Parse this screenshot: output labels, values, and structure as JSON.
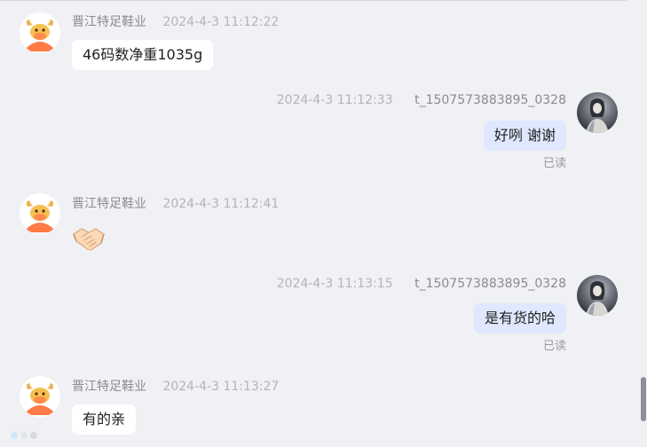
{
  "messages": [
    {
      "side": "left",
      "sender": "晋江特足鞋业",
      "time": "2024-4-3 11:12:22",
      "text": "46码数净重1035g"
    },
    {
      "side": "right",
      "sender": "t_1507573883895_0328",
      "time": "2024-4-3 11:12:33",
      "text": "好咧 谢谢",
      "status": "已读"
    },
    {
      "side": "left",
      "sender": "晋江特足鞋业",
      "time": "2024-4-3 11:12:41",
      "emoji": "handshake-emoji"
    },
    {
      "side": "right",
      "sender": "t_1507573883895_0328",
      "time": "2024-4-3 11:13:15",
      "text": "是有货的哈",
      "status": "已读"
    },
    {
      "side": "left",
      "sender": "晋江特足鞋业",
      "time": "2024-4-3 11:13:27",
      "text": "有的亲"
    }
  ],
  "colors": {
    "background": "#f0f1f5",
    "bubble_left": "#ffffff",
    "bubble_right": "#dfe8fe",
    "shop_avatar": "#ff7a45"
  }
}
